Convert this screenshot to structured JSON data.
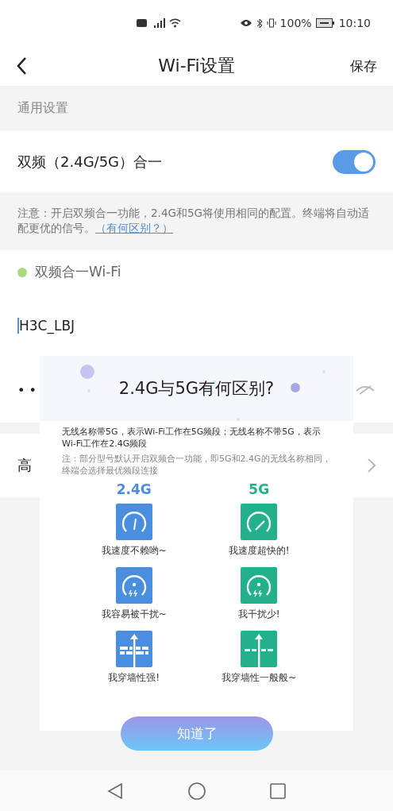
{
  "status_bar": {
    "battery": "100%",
    "time": "10:10"
  },
  "header": {
    "title": "Wi-Fi设置",
    "action": "保存"
  },
  "general": {
    "heading": "通用设置",
    "toggle_label": "双频（2.4G/5G）合一",
    "on": true
  },
  "note": {
    "text": "注意：开启双频合一功能，2.4G和5G将使用相同的配置。终端将自动适配更优的信号。",
    "link": "（有何区别？）"
  },
  "wifi": {
    "label": "双频合一Wi-Fi",
    "ssid": "H3C_LBJ",
    "password": "• •"
  },
  "advanced": {
    "label": "高"
  },
  "popup": {
    "title": "2.4G与5G有何区别?",
    "description": "无线名称带5G，表示Wi-Fi工作在5G频段；无线名称不带5G，表示Wi-Fi工作在2.4G频段",
    "note": "注：部分型号默认开启双频合一功能，即5G和2.4G的无线名称相同，终端会选择最优频段连接",
    "columns": [
      {
        "band": "2.4G",
        "color": "#4a8ee0",
        "features": [
          {
            "kind": "speed",
            "slow": true,
            "text": "我速度不赖哟~"
          },
          {
            "kind": "interference",
            "text": "我容易被干扰~"
          },
          {
            "kind": "wall",
            "strong": true,
            "text": "我穿墙性强!"
          }
        ]
      },
      {
        "band": "5G",
        "color": "#23b08c",
        "features": [
          {
            "kind": "speed",
            "slow": false,
            "text": "我速度超快的!"
          },
          {
            "kind": "interference",
            "text": "我干扰少!"
          },
          {
            "kind": "wall",
            "strong": false,
            "text": "我穿墙性一般般~"
          }
        ]
      }
    ],
    "button": "知道了"
  }
}
